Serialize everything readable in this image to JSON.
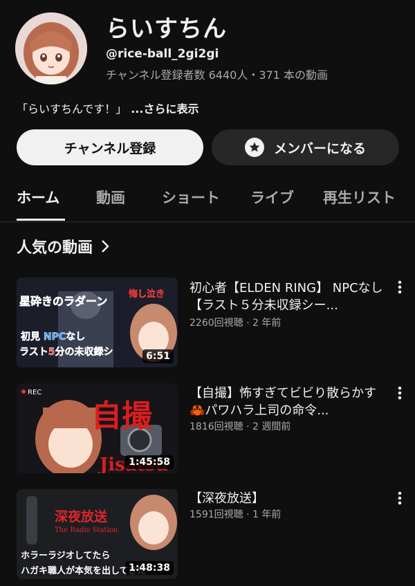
{
  "channel": {
    "name": "らいすちん",
    "handle": "@rice-ball_2gi2gi",
    "stats": "チャンネル登録者数 6440人・371 本の動画",
    "description": "「らいすちんです！」",
    "more": "...さらに表示"
  },
  "buttons": {
    "subscribe": "チャンネル登録",
    "member": "メンバーになる"
  },
  "tabs": [
    "ホーム",
    "動画",
    "ショート",
    "ライブ",
    "再生リスト"
  ],
  "section": {
    "title": "人気の動画"
  },
  "videos": [
    {
      "title": "初心者【ELDEN RING】 NPCなし【ラスト５分未収録シー...",
      "meta": "2260回視聴 · 2 年前",
      "duration": "6:51",
      "thumb_text": [
        "星砕きのラダーン",
        "悔し泣き",
        "初見 NPCなし",
        "ラスト5分の未収録シ"
      ]
    },
    {
      "title": "【自撮】怖すぎてビビり散らかす🦀パワハラ上司の命令...",
      "meta": "1816回視聴 · 2 週間前",
      "duration": "1:45:58",
      "thumb_text": [
        "REC",
        "自撮",
        "Jisatsu"
      ]
    },
    {
      "title": "【深夜放送】",
      "meta": "1591回視聴 · 1 年前",
      "duration": "1:48:38",
      "thumb_text": [
        "深夜放送",
        "The Radio Station",
        "ホラーラジオしてたら",
        "ハガキ職人が本気を出してきた"
      ]
    }
  ],
  "colors": {
    "background": "#0f0f0f",
    "subscribe_bg": "#f1f1f1",
    "member_bg": "#272727",
    "muted_text": "#aaaaaa"
  }
}
